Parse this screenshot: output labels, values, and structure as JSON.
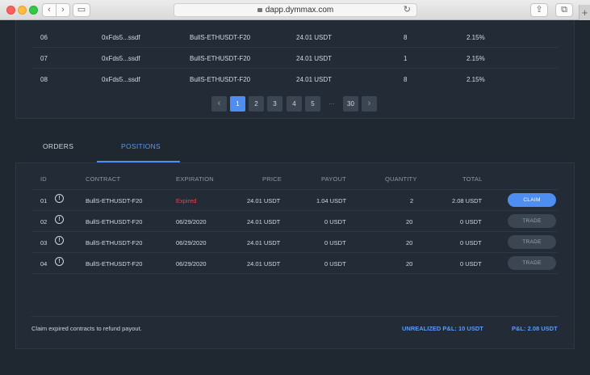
{
  "browser": {
    "url": "dapp.dymmax.com",
    "back_glyph": "‹",
    "forward_glyph": "›",
    "reload_glyph": "↻",
    "share_glyph": "⇪",
    "tabs_glyph": "⧉",
    "sidebar_glyph": "▭",
    "plus_glyph": "+"
  },
  "top_table": {
    "rows": [
      {
        "id": "06",
        "address": "0xFds5...ssdf",
        "contract": "BullS-ETHUSDT-F20",
        "price": "24.01 USDT",
        "qty": "8",
        "pct": "2.15%"
      },
      {
        "id": "07",
        "address": "0xFds5...ssdf",
        "contract": "BullS-ETHUSDT-F20",
        "price": "24.01 USDT",
        "qty": "1",
        "pct": "2.15%"
      },
      {
        "id": "08",
        "address": "0xFds5...ssdf",
        "contract": "BullS-ETHUSDT-F20",
        "price": "24.01 USDT",
        "qty": "8",
        "pct": "2.15%"
      }
    ]
  },
  "pagination": {
    "prev": "‹",
    "pages": [
      "1",
      "2",
      "3",
      "4",
      "5"
    ],
    "ellipsis": "···",
    "last": "30",
    "next": "›",
    "active": "1"
  },
  "tabs": {
    "orders": "ORDERS",
    "positions": "POSITIONS"
  },
  "positions": {
    "headers": {
      "id": "ID",
      "contract": "CONTRACT",
      "expiration": "EXPIRATION",
      "price": "PRICE",
      "payout": "PAYOUT",
      "quantity": "QUANTITY",
      "total": "TOTAL"
    },
    "info_glyph": "!",
    "rows": [
      {
        "id": "01",
        "contract": "BullS-ETHUSDT-F20",
        "expiration": "Expired",
        "price": "24.01 USDT",
        "payout": "1.04 USDT",
        "quantity": "2",
        "total": "2.08 USDT",
        "action": "CLAIM"
      },
      {
        "id": "02",
        "contract": "BullS-ETHUSDT-F20",
        "expiration": "06/29/2020",
        "price": "24.01 USDT",
        "payout": "0 USDT",
        "quantity": "20",
        "total": "0 USDT",
        "action": "TRADE"
      },
      {
        "id": "03",
        "contract": "BullS-ETHUSDT-F20",
        "expiration": "06/29/2020",
        "price": "24.01 USDT",
        "payout": "0 USDT",
        "quantity": "20",
        "total": "0 USDT",
        "action": "TRADE"
      },
      {
        "id": "04",
        "contract": "BullS-ETHUSDT-F20",
        "expiration": "06/29/2020",
        "price": "24.01 USDT",
        "payout": "0 USDT",
        "quantity": "20",
        "total": "0 USDT",
        "action": "TRADE"
      }
    ]
  },
  "footer": {
    "note": "Claim expired contracts to refund payout.",
    "unrealized": "UNREALIZED P&L: 10 USDT",
    "pnl": "P&L: 2.08 USDT"
  },
  "colors": {
    "accent": "#4e8df2",
    "expired": "#e04848",
    "background": "#1f2731"
  }
}
